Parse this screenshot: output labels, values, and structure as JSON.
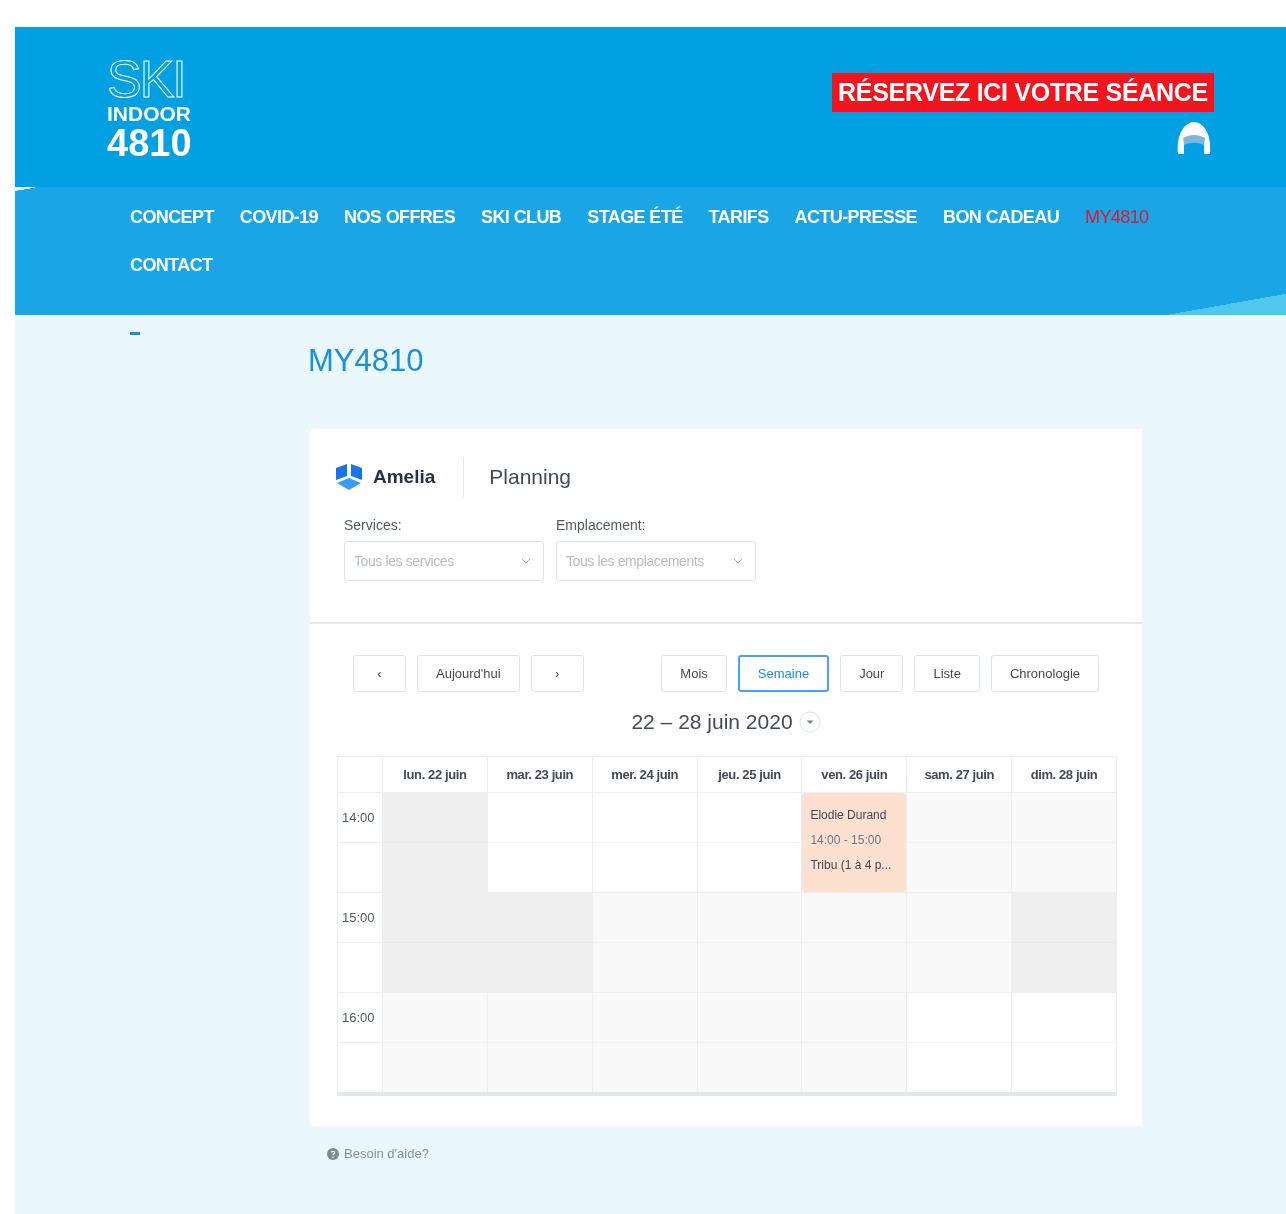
{
  "header": {
    "logo": {
      "line_1": "SKI",
      "line_2": "INDOOR",
      "line_3": "4810"
    },
    "cta": "RÉSERVEZ ICI VOTRE SÉANCE"
  },
  "nav": [
    {
      "label": "CONCEPT",
      "selected": false
    },
    {
      "label": "COVID-19",
      "selected": false
    },
    {
      "label": "NOS OFFRES",
      "selected": false
    },
    {
      "label": "SKI CLUB",
      "selected": false
    },
    {
      "label": "STAGE ÉTÉ",
      "selected": false
    },
    {
      "label": "TARIFS",
      "selected": false
    },
    {
      "label": "ACTU-PRESSE",
      "selected": false
    },
    {
      "label": "BON CADEAU",
      "selected": false
    },
    {
      "label": "MY4810",
      "selected": true
    },
    {
      "label": "CONTACT",
      "selected": false
    }
  ],
  "page_title": "MY4810",
  "widget": {
    "brand": "Amelia",
    "title": "Planning",
    "filters": [
      {
        "label": "Services:",
        "placeholder": "Tous les services"
      },
      {
        "label": "Emplacement:",
        "placeholder": "Tous les emplacements"
      }
    ],
    "nav_buttons": [
      {
        "label": "‹"
      },
      {
        "label": "Aujourd'hui"
      },
      {
        "label": "›"
      }
    ],
    "views": [
      {
        "label": "Mois",
        "selected": false
      },
      {
        "label": "Semaine",
        "selected": true
      },
      {
        "label": "Jour",
        "selected": false
      },
      {
        "label": "Liste",
        "selected": false
      },
      {
        "label": "Chronologie",
        "selected": false
      }
    ],
    "range": "22 – 28 juin 2020",
    "days": [
      "lun. 22 juin",
      "mar. 23 juin",
      "mer. 24 juin",
      "jeu. 25 juin",
      "ven. 26 juin",
      "sam. 27 juin",
      "dim. 28 juin"
    ],
    "rows": [
      {
        "time": "14:00",
        "cells": [
          {
            "kind": "dark"
          },
          {
            "kind": "plain"
          },
          {
            "kind": "plain"
          },
          {
            "kind": "plain"
          },
          {
            "kind": "event",
            "color": "#fde0d0",
            "name": "Elodie Durand",
            "hours": "14:00 - 15:00",
            "service": "Tribu (1 à 4 p..."
          },
          {
            "kind": "shaded"
          },
          {
            "kind": "shaded"
          }
        ]
      },
      {
        "time": "15:00",
        "cells": [
          {
            "kind": "dark"
          },
          {
            "kind": "dark"
          },
          {
            "kind": "shaded"
          },
          {
            "kind": "shaded"
          },
          {
            "kind": "shaded"
          },
          {
            "kind": "shaded"
          },
          {
            "kind": "dark"
          }
        ]
      },
      {
        "time": "16:00",
        "cells": [
          {
            "kind": "shaded"
          },
          {
            "kind": "shaded"
          },
          {
            "kind": "shaded"
          },
          {
            "kind": "shaded"
          },
          {
            "kind": "shaded"
          },
          {
            "kind": "plain"
          },
          {
            "kind": "plain"
          }
        ]
      }
    ]
  },
  "help": "Besoin d'aide?"
}
